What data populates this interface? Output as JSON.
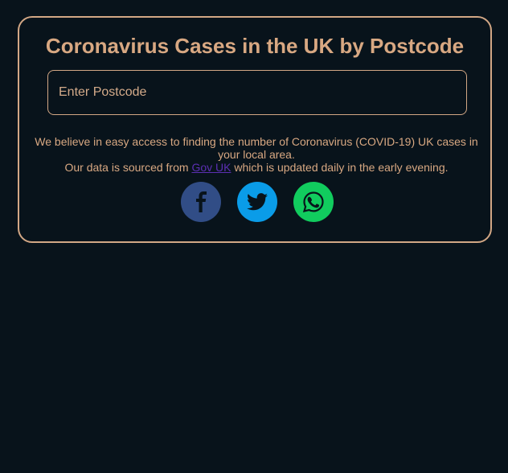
{
  "header": {
    "title": "Coronavirus Cases in the UK by Postcode"
  },
  "search": {
    "placeholder": "Enter Postcode",
    "value": ""
  },
  "description": {
    "line1": "We believe in easy access to finding the number of Coronavirus (COVID-19) UK cases in your local area.",
    "line2_before": "Our data is sourced from ",
    "line2_link": "Gov UK",
    "line2_after": " which is updated daily in the early evening."
  },
  "share": {
    "facebook_icon": "facebook-icon",
    "twitter_icon": "twitter-icon",
    "whatsapp_icon": "whatsapp-icon"
  },
  "colors": {
    "background": "#08131b",
    "accent": "#d2a785",
    "link": "#5c2fb3",
    "facebook": "#314d86",
    "twitter": "#0a9ce8",
    "whatsapp": "#11cc5e"
  }
}
